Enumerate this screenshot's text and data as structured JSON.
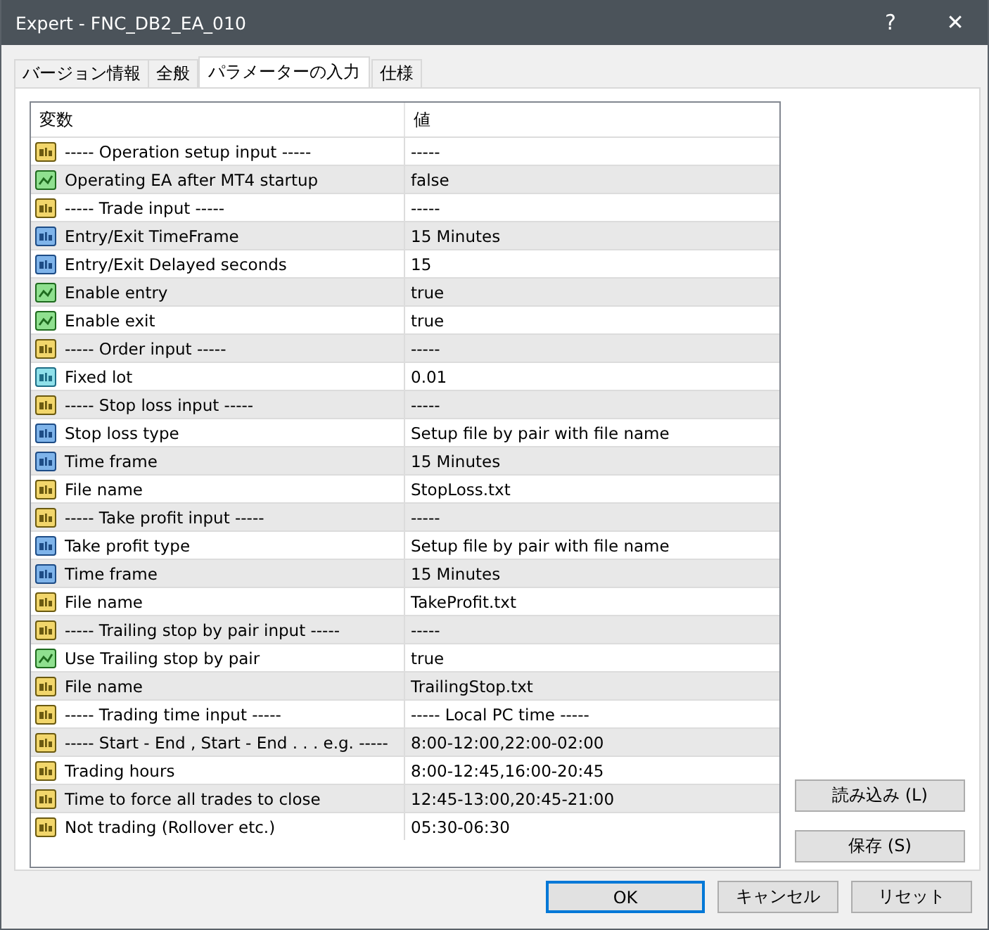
{
  "window": {
    "title": "Expert - FNC_DB2_EA_010",
    "help": "?",
    "close": "✕"
  },
  "tabs": [
    {
      "label": "バージョン情報",
      "selected": false
    },
    {
      "label": "全般",
      "selected": false
    },
    {
      "label": "パラメーターの入力",
      "selected": true
    },
    {
      "label": "仕様",
      "selected": false
    }
  ],
  "table": {
    "columns": [
      "変数",
      "値"
    ],
    "rows": [
      {
        "kind": "string",
        "name": "----- Operation setup input -----",
        "value": "-----"
      },
      {
        "kind": "bool",
        "name": "Operating EA after MT4 startup",
        "value": "false"
      },
      {
        "kind": "string",
        "name": "----- Trade input -----",
        "value": "-----"
      },
      {
        "kind": "int",
        "name": "Entry/Exit TimeFrame",
        "value": "15 Minutes"
      },
      {
        "kind": "int",
        "name": "Entry/Exit Delayed seconds",
        "value": "15"
      },
      {
        "kind": "bool",
        "name": "Enable entry",
        "value": "true"
      },
      {
        "kind": "bool",
        "name": "Enable exit",
        "value": "true"
      },
      {
        "kind": "string",
        "name": "----- Order input -----",
        "value": "-----"
      },
      {
        "kind": "double",
        "name": "Fixed lot",
        "value": "0.01"
      },
      {
        "kind": "string",
        "name": "----- Stop loss input -----",
        "value": "-----"
      },
      {
        "kind": "int",
        "name": "Stop loss type",
        "value": "Setup file by pair with file name"
      },
      {
        "kind": "int",
        "name": "Time frame",
        "value": "15 Minutes"
      },
      {
        "kind": "string",
        "name": "File name",
        "value": "StopLoss.txt"
      },
      {
        "kind": "string",
        "name": "----- Take profit input -----",
        "value": "-----"
      },
      {
        "kind": "int",
        "name": "Take profit type",
        "value": "Setup file by pair with file name"
      },
      {
        "kind": "int",
        "name": "Time frame",
        "value": "15 Minutes"
      },
      {
        "kind": "string",
        "name": "File name",
        "value": "TakeProfit.txt"
      },
      {
        "kind": "string",
        "name": "----- Trailing stop by pair input -----",
        "value": "-----"
      },
      {
        "kind": "bool",
        "name": "Use Trailing stop by pair",
        "value": "true"
      },
      {
        "kind": "string",
        "name": "File name",
        "value": "TrailingStop.txt"
      },
      {
        "kind": "string",
        "name": "----- Trading time input -----",
        "value": "----- Local PC time -----"
      },
      {
        "kind": "string",
        "name": "----- Start - End , Start - End . . . e.g. -----",
        "value": "8:00-12:00,22:00-02:00"
      },
      {
        "kind": "string",
        "name": "Trading hours",
        "value": "8:00-12:45,16:00-20:45"
      },
      {
        "kind": "string",
        "name": "Time to force all trades to close",
        "value": "12:45-13:00,20:45-21:00"
      },
      {
        "kind": "string",
        "name": "Not trading (Rollover etc.)",
        "value": "05:30-06:30"
      }
    ]
  },
  "side_buttons": [
    "読み込み (L)",
    "保存 (S)"
  ],
  "buttons": [
    {
      "label": "OK",
      "focused": true
    },
    {
      "label": "キャンセル",
      "focused": false
    },
    {
      "label": "リセット",
      "focused": false
    }
  ]
}
